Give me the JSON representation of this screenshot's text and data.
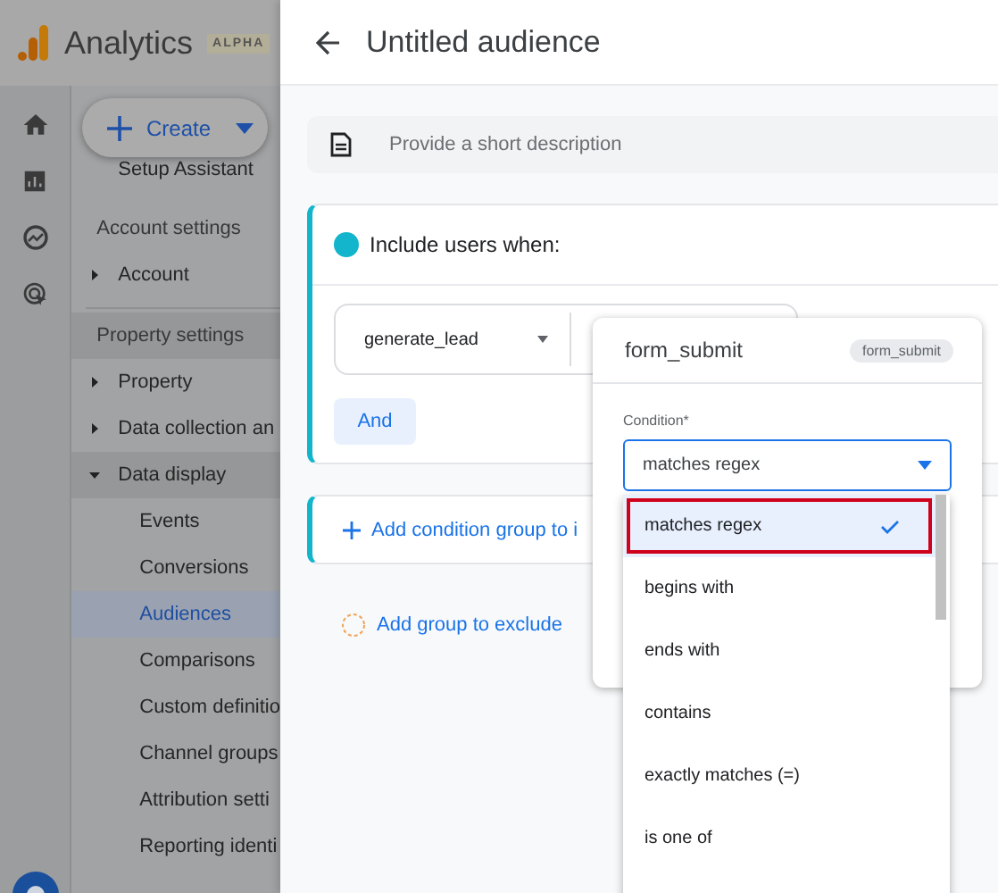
{
  "app": {
    "name": "Analytics",
    "badge": "ALPHA",
    "create_button": "Create"
  },
  "nav": {
    "top_item": "Setup Assistant",
    "groups": [
      {
        "title": "Account settings",
        "active": false,
        "items": [
          {
            "label": "Account",
            "expanded": false
          }
        ]
      },
      {
        "title": "Property settings",
        "active": true,
        "items": [
          {
            "label": "Property",
            "expanded": false
          },
          {
            "label": "Data collection an",
            "expanded": false
          },
          {
            "label": "Data display",
            "expanded": true,
            "children": [
              {
                "label": "Events",
                "selected": false
              },
              {
                "label": "Conversions",
                "selected": false
              },
              {
                "label": "Audiences",
                "selected": true
              },
              {
                "label": "Comparisons",
                "selected": false
              },
              {
                "label": "Custom definitio",
                "selected": false
              },
              {
                "label": "Channel groups",
                "selected": false
              },
              {
                "label": "Attribution setti",
                "selected": false
              },
              {
                "label": "Reporting identi",
                "selected": false
              }
            ]
          }
        ]
      }
    ]
  },
  "audience": {
    "title": "Untitled audience",
    "description_placeholder": "Provide a short description",
    "include": {
      "title": "Include users when:",
      "event_select": "generate_lead",
      "and_button": "And"
    },
    "add_condition_group": "Add condition group to i",
    "add_exclude": "Add group to exclude"
  },
  "event_popup": {
    "title": "form_submit",
    "chip": "form_submit",
    "condition_label": "Condition*",
    "condition_value": "matches regex",
    "options": [
      {
        "label": "matches regex",
        "selected": true
      },
      {
        "label": "begins with",
        "selected": false
      },
      {
        "label": "ends with",
        "selected": false
      },
      {
        "label": "contains",
        "selected": false
      },
      {
        "label": "exactly matches (=)",
        "selected": false
      },
      {
        "label": "is one of",
        "selected": false
      }
    ]
  }
}
